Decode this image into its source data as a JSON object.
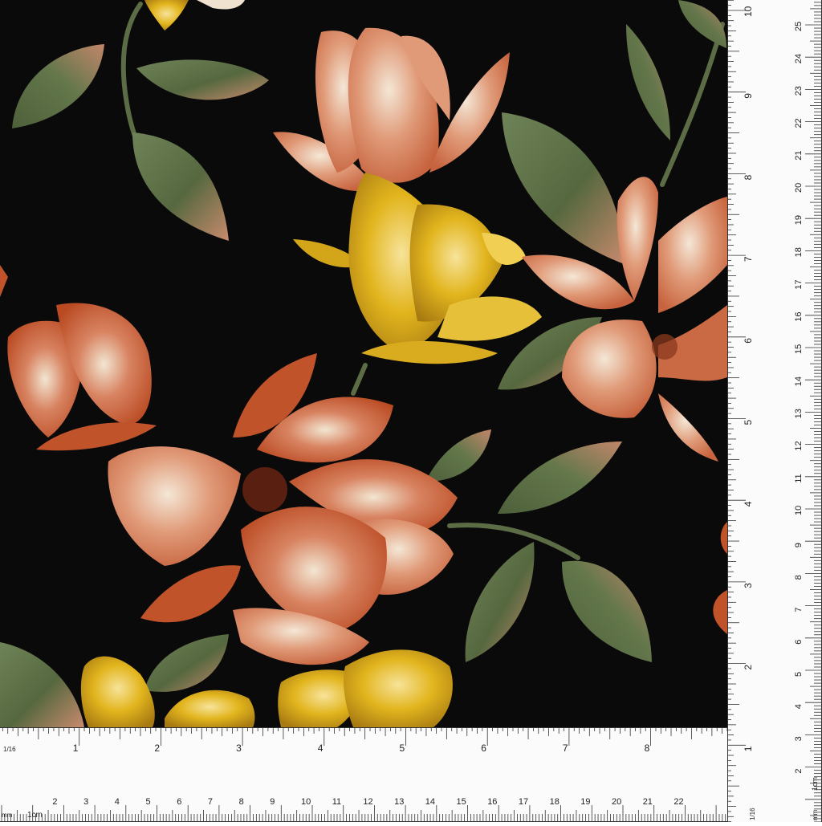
{
  "colors": {
    "background": "#0b0a0a",
    "rust": "#c0532a",
    "salmon": "#d98a6a",
    "cream": "#efe3cf",
    "mustard": "#e2b51e",
    "leaf": "#5b6e47",
    "ruler": "#fbfbfb",
    "tick": "#333333"
  },
  "ruler_bottom": {
    "inch_unit": "1/16",
    "inch_numbers": [
      "1",
      "2",
      "3",
      "4",
      "5",
      "6",
      "7",
      "8"
    ],
    "cm_unit_mm": "mm",
    "cm_unit_cm": "1cm",
    "cm_numbers": [
      "2",
      "3",
      "4",
      "5",
      "6",
      "7",
      "8",
      "9",
      "10",
      "11",
      "12",
      "13",
      "14",
      "15",
      "16",
      "17",
      "18",
      "19",
      "20",
      "21",
      "22"
    ]
  },
  "ruler_right": {
    "inch_numbers": [
      "10",
      "9",
      "8",
      "7",
      "6",
      "5",
      "4",
      "3",
      "2",
      "1"
    ],
    "cm_numbers": [
      "25",
      "24",
      "23",
      "22",
      "21",
      "20",
      "19",
      "18",
      "17",
      "16",
      "15",
      "14",
      "13",
      "12",
      "11",
      "10",
      "9",
      "8",
      "7",
      "6",
      "5",
      "4",
      "3",
      "2"
    ],
    "cm_unit_cm": "1cm",
    "cm_unit_mm": "mm",
    "inch_unit": "1/16"
  }
}
